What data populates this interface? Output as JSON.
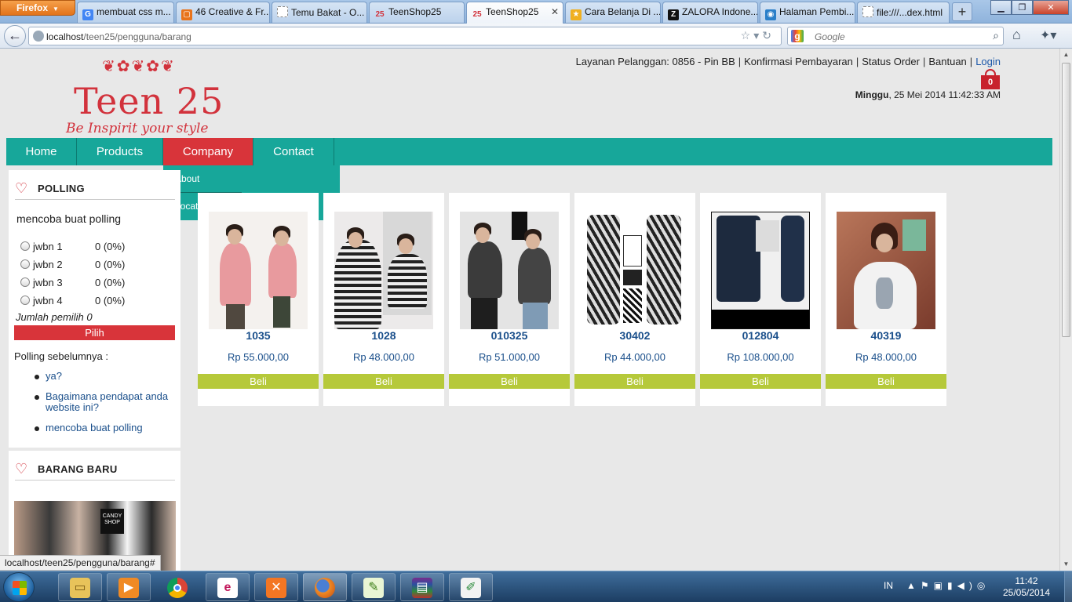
{
  "browser": {
    "menu_button": "Firefox",
    "tabs": [
      {
        "label": "membuat css m...",
        "favicon": "G",
        "color": "#4285f4"
      },
      {
        "label": "46 Creative & Fr...",
        "favicon": "▢",
        "color": "#e8731b"
      },
      {
        "label": "Temu Bakat - O...",
        "favicon": "",
        "color": "#c0c0c0"
      },
      {
        "label": "TeenShop25",
        "favicon": "25",
        "color": "#d2323c"
      },
      {
        "label": "TeenShop25",
        "favicon": "25",
        "color": "#d2323c"
      },
      {
        "label": "Cara Belanja Di ...",
        "favicon": "★",
        "color": "#f0b020"
      },
      {
        "label": "ZALORA Indone...",
        "favicon": "Z",
        "color": "#111111"
      },
      {
        "label": "Halaman Pembi...",
        "favicon": "◉",
        "color": "#2a7fc9"
      },
      {
        "label": "file:///...dex.html",
        "favicon": "",
        "color": "#c0c0c0"
      }
    ],
    "url_host": "localhost",
    "url_path": "/teen25/pengguna/barang",
    "search_placeholder": "Google",
    "status_text": "localhost/teen25/pengguna/barang#"
  },
  "header": {
    "logo_text": "Teen 25",
    "logo_tagline": "Be Inspirit your style",
    "top_links": {
      "customer_service": "Layanan Pelanggan: 0856 - Pin BB",
      "payment": "Konfirmasi Pembayaran",
      "order_status": "Status Order",
      "help": "Bantuan",
      "login": "Login"
    },
    "cart_count": "0",
    "date_day": "Minggu",
    "date_rest": ", 25 Mei 2014 11:42:33 AM"
  },
  "menu": {
    "items": [
      "Home",
      "Products",
      "Company",
      "Contact"
    ],
    "dropdown": [
      "About",
      "Location"
    ]
  },
  "polling": {
    "title": "POLLING",
    "question": "mencoba buat polling",
    "options": [
      {
        "label": "jwbn 1",
        "result": "0 (0%)"
      },
      {
        "label": "jwbn 2",
        "result": "0 (0%)"
      },
      {
        "label": "jwbn 3",
        "result": "0 (0%)"
      },
      {
        "label": "jwbn 4",
        "result": "0 (0%)"
      }
    ],
    "total": "Jumlah pemilih 0",
    "submit": "Pilih",
    "previous_label": "Polling sebelumnya :",
    "previous": [
      "ya?",
      "Bagaimana pendapat anda website ini?",
      "mencoba buat polling"
    ]
  },
  "new_items": {
    "title": "BARANG BARU",
    "image_text": "CANDY SHOP"
  },
  "products": [
    {
      "code": "1035",
      "price": "Rp 55.000,00",
      "buy": "Beli"
    },
    {
      "code": "1028",
      "price": "Rp 48.000,00",
      "buy": "Beli"
    },
    {
      "code": "010325",
      "price": "Rp 51.000,00",
      "buy": "Beli"
    },
    {
      "code": "30402",
      "price": "Rp 44.000,00",
      "buy": "Beli"
    },
    {
      "code": "012804",
      "price": "Rp 108.000,00",
      "buy": "Beli"
    },
    {
      "code": "40319",
      "price": "Rp 48.000,00",
      "buy": "Beli"
    }
  ],
  "taskbar": {
    "apps": [
      "windows-explorer",
      "media-player",
      "chrome",
      "smartren",
      "xampp",
      "firefox",
      "notepad-plus-plus",
      "winrar",
      "paint"
    ],
    "language": "IN",
    "time": "11:42",
    "date": "25/05/2014"
  }
}
